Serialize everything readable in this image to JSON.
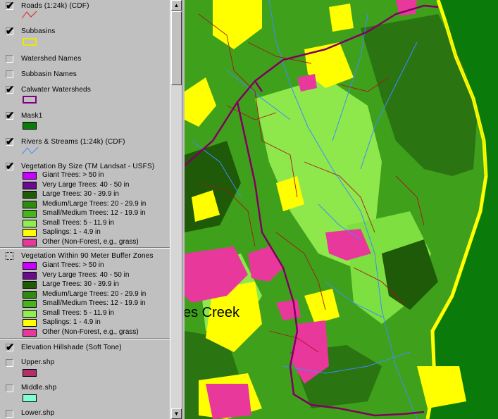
{
  "legend": {
    "layers": [
      {
        "name": "Roads (1:24k) (CDF)",
        "checked": true,
        "symbol": "road-line"
      },
      {
        "name": "Subbasins",
        "checked": true,
        "symbol": "yellow-outline"
      },
      {
        "name": "Watershed Names",
        "checked": false
      },
      {
        "name": "Subbasin Names",
        "checked": false
      },
      {
        "name": "Calwater Watersheds",
        "checked": true,
        "symbol": "purple-outline"
      },
      {
        "name": "Mask1",
        "checked": true,
        "symbol": "green-fill"
      },
      {
        "name": "Rivers & Streams (1:24k) (CDF)",
        "checked": true,
        "symbol": "stream-line"
      },
      {
        "name": "Vegetation By Size (TM Landsat - USFS)",
        "checked": true
      },
      {
        "name": "Vegetation Within 90 Meter Buffer Zones",
        "checked": false
      },
      {
        "name": "Elevation Hillshade (Soft Tone)",
        "checked": true
      },
      {
        "name": "Upper.shp",
        "checked": false
      },
      {
        "name": "Middle.shp",
        "checked": false
      },
      {
        "name": "Lower.shp",
        "checked": false
      }
    ],
    "veg_classes": [
      {
        "label": "Giant Trees: > 50 in",
        "color": "#c800ff"
      },
      {
        "label": "Very Large Trees: 40 - 50 in",
        "color": "#6a0a8c"
      },
      {
        "label": "Large Trees: 30 - 39.9 in",
        "color": "#1e5a08"
      },
      {
        "label": "Medium/Large Trees: 20 - 29.9 in",
        "color": "#2f8a10"
      },
      {
        "label": "Small/Medium Trees: 12 - 19.9 in",
        "color": "#46b41a"
      },
      {
        "label": "Small Trees: 5 - 11.9 in",
        "color": "#90ee50"
      },
      {
        "label": "Saplings: 1 - 4.9 in",
        "color": "#ffff00"
      },
      {
        "label": "Other (Non-Forest, e.g., grass)",
        "color": "#e8389c"
      }
    ],
    "upper_color": "#b0306a",
    "middle_color": "#7fffd4"
  },
  "map": {
    "label": "es Creek"
  }
}
